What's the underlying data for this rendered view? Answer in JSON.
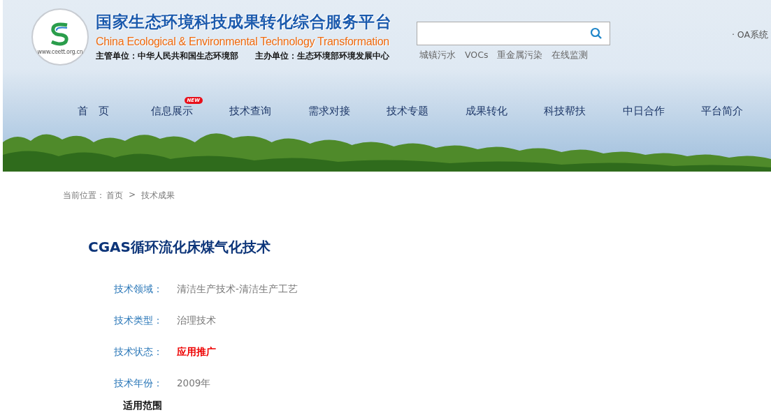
{
  "header": {
    "logo_url": "www.ceett.org.cn",
    "title": "国家生态环境科技成果转化综合服务平台",
    "subtitle_en": "China Ecological & Environmental Technology Transformation",
    "organizers": [
      "主管单位：中华人民共和国生态环境部",
      "主办单位：生态环境部环境发展中心"
    ],
    "quick_links": [
      "城镇污水",
      "VOCs",
      "重金属污染",
      "在线监测"
    ],
    "oa_link": "· OA系统"
  },
  "nav": [
    {
      "label": "首　页"
    },
    {
      "label": "信息展示",
      "badge": "NEW"
    },
    {
      "label": "技术查询"
    },
    {
      "label": "需求对接"
    },
    {
      "label": "技术专题"
    },
    {
      "label": "成果转化"
    },
    {
      "label": "科技帮扶"
    },
    {
      "label": "中日合作"
    },
    {
      "label": "平台简介"
    }
  ],
  "breadcrumb": {
    "prefix": "当前位置：",
    "items": [
      "首页",
      "技术成果"
    ],
    "separator": ">"
  },
  "article": {
    "title": "CGAS循环流化床煤气化技术",
    "fields": [
      {
        "label": "技术领域：",
        "value": "清洁生产技术-清洁生产工艺",
        "kind": "plain"
      },
      {
        "label": "技术类型：",
        "value": "治理技术",
        "kind": "plain"
      },
      {
        "label": "技术状态：",
        "value": "应用推广",
        "kind": "highlight"
      },
      {
        "label": "技术年份：",
        "value": "2009年",
        "kind": "plain"
      }
    ],
    "section_heading": "适用范围"
  }
}
